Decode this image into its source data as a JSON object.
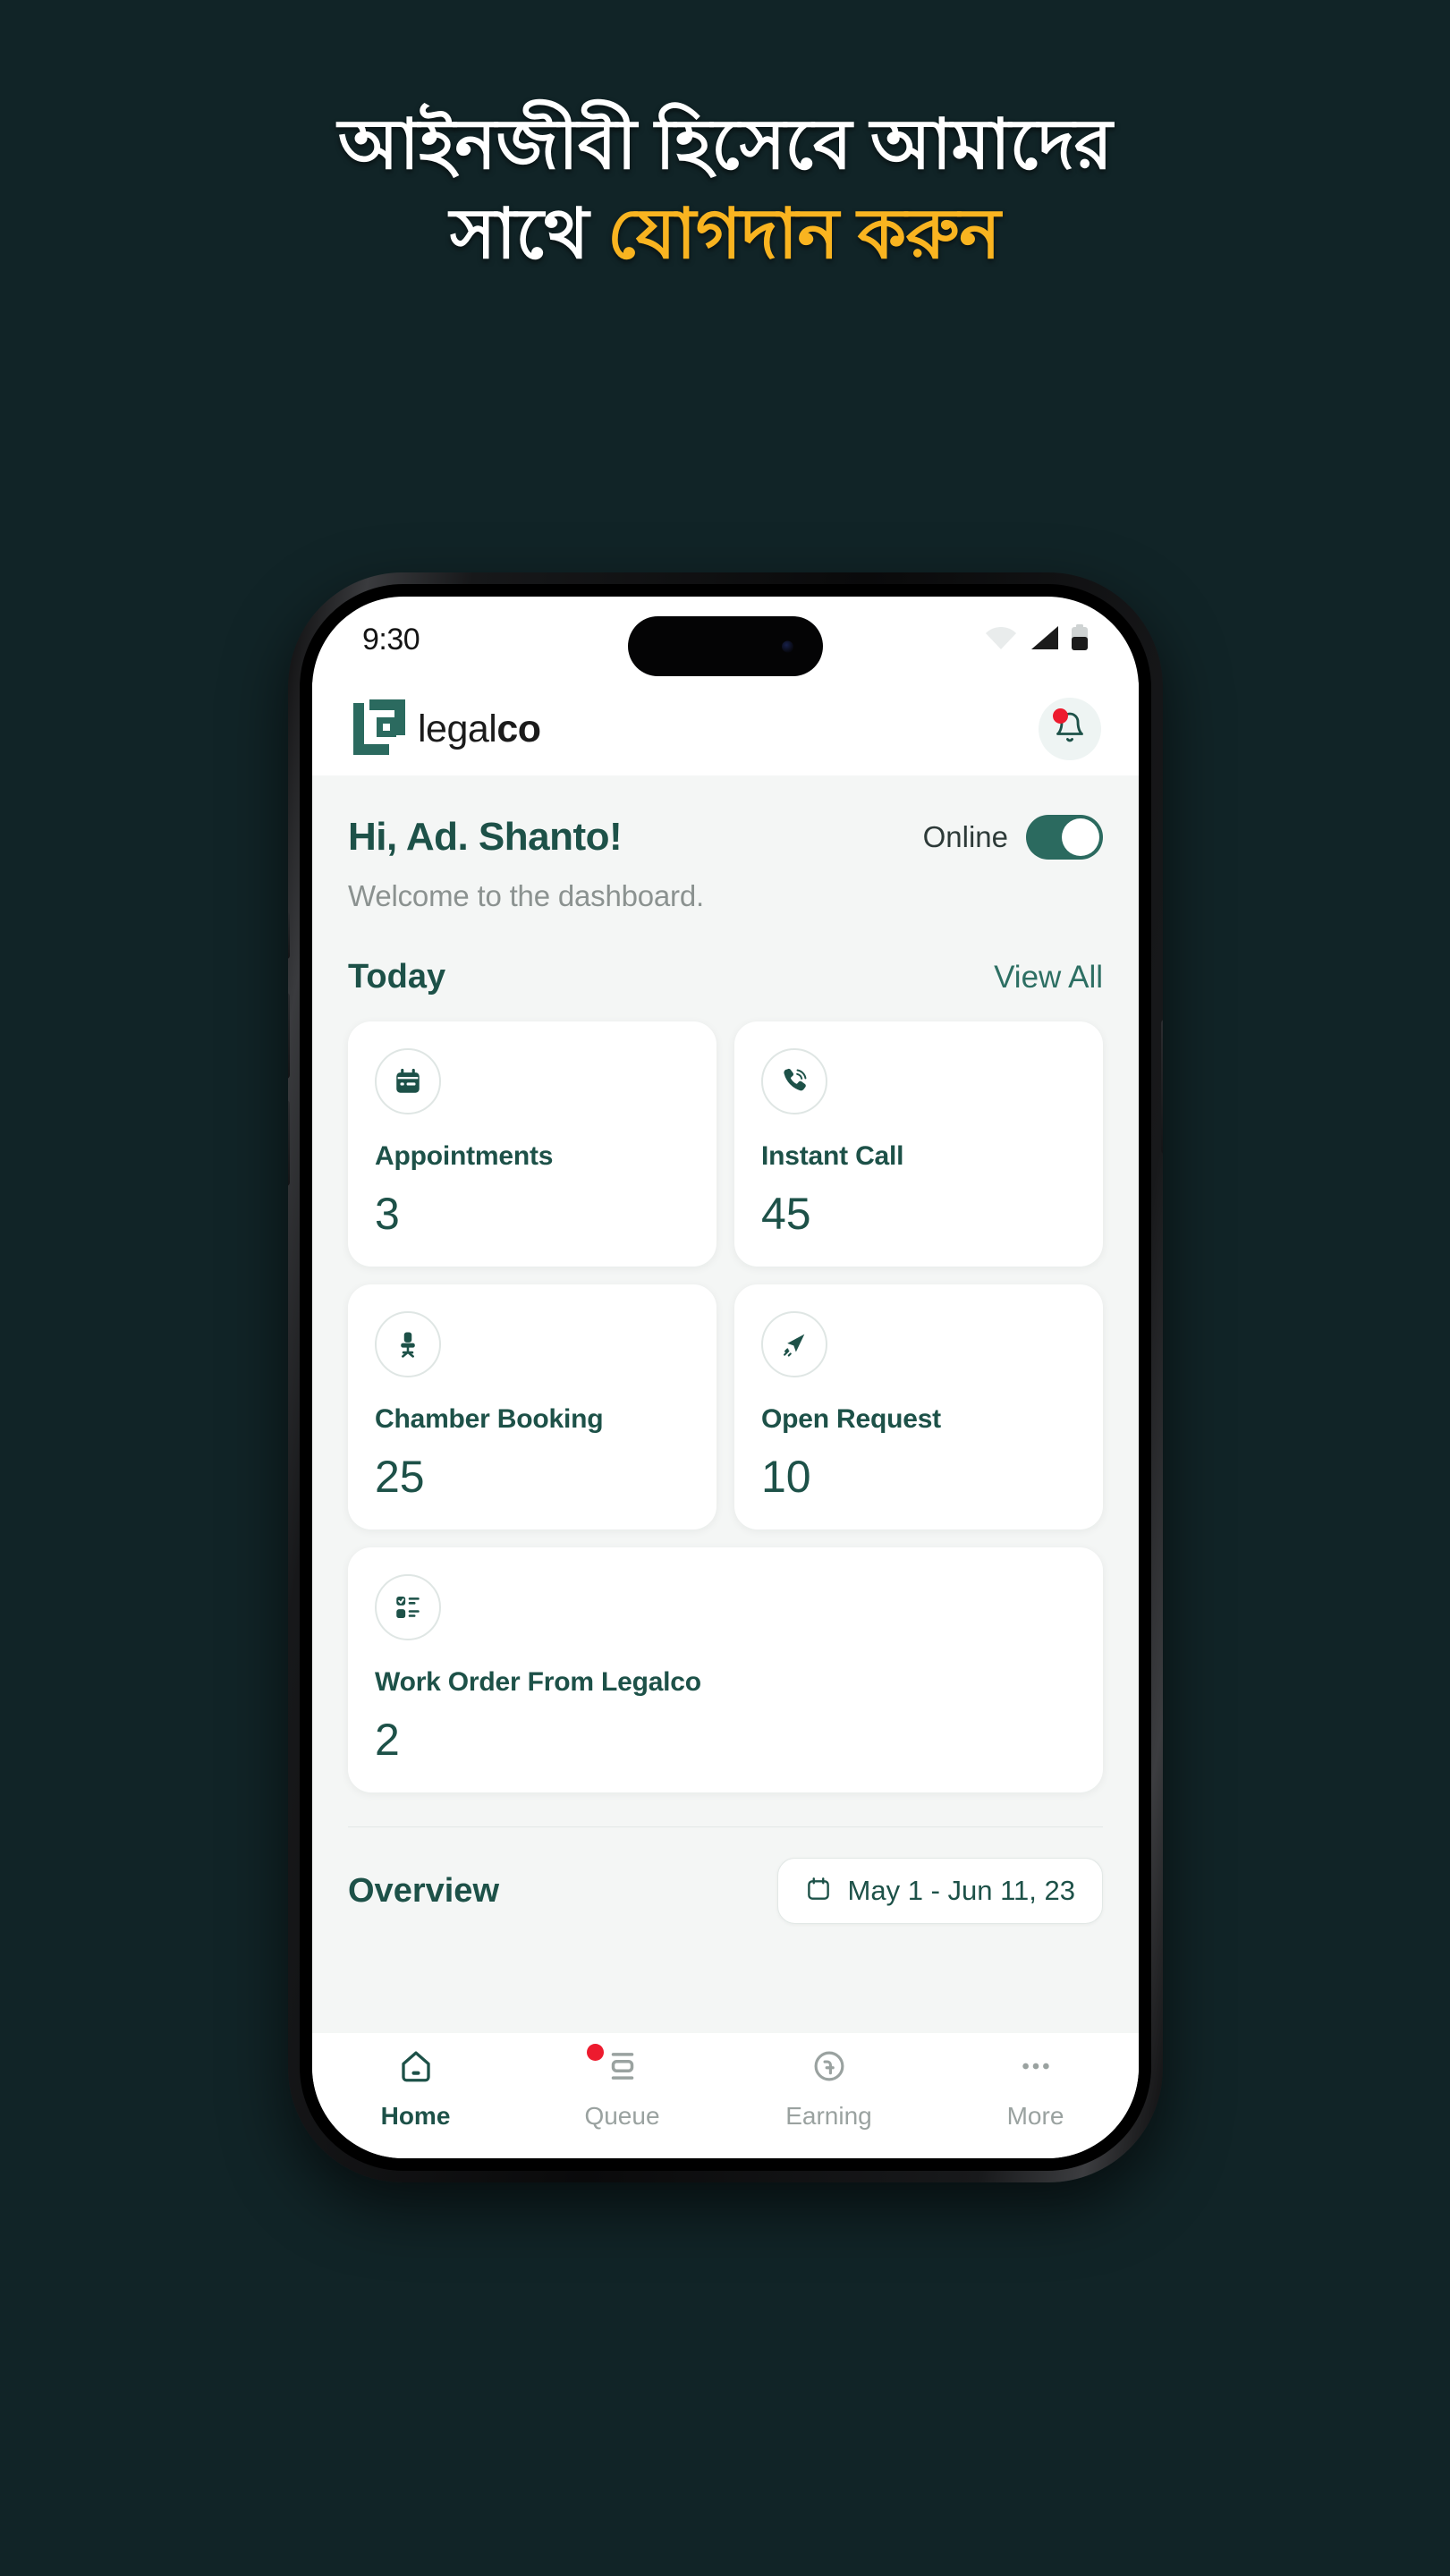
{
  "promo": {
    "headline_line1": "আইনজীবী হিসেবে আমাদের",
    "headline_line2_white": "সাথে ",
    "headline_line2_accent": "যোগদান করুন",
    "background_color": "#112427",
    "accent_color": "#F9B420"
  },
  "status_bar": {
    "time": "9:30",
    "icons": [
      "wifi-icon",
      "cellular-signal-icon",
      "battery-icon"
    ]
  },
  "app_header": {
    "brand_light": "legal",
    "brand_bold": "co",
    "logo_icon": "legalco-logo-icon",
    "notification_icon": "bell-icon",
    "notification_badge": true
  },
  "greeting": {
    "title": "Hi, Ad. Shanto!",
    "subtitle": "Welcome to the dashboard.",
    "online_label": "Online",
    "online_state": "on"
  },
  "today": {
    "title": "Today",
    "view_all": "View All",
    "cards": [
      {
        "icon": "calendar-icon",
        "label": "Appointments",
        "value": "3"
      },
      {
        "icon": "phone-ringing-icon",
        "label": "Instant Call",
        "value": "45"
      },
      {
        "icon": "office-chair-icon",
        "label": "Chamber Booking",
        "value": "25"
      },
      {
        "icon": "paper-plane-icon",
        "label": "Open Request",
        "value": "10"
      },
      {
        "icon": "checklist-icon",
        "label": "Work Order From Legalco",
        "value": "2"
      }
    ]
  },
  "overview": {
    "title": "Overview",
    "date_range": "May 1 - Jun 11, 23",
    "calendar_icon": "calendar-icon"
  },
  "bottom_nav": {
    "items": [
      {
        "label": "Home",
        "icon": "home-icon",
        "active": true,
        "badge": false
      },
      {
        "label": "Queue",
        "icon": "queue-icon",
        "active": false,
        "badge": true
      },
      {
        "label": "Earning",
        "icon": "taka-circle-icon",
        "active": false,
        "badge": false
      },
      {
        "label": "More",
        "icon": "ellipsis-icon",
        "active": false,
        "badge": false
      }
    ]
  },
  "theme": {
    "primary": "#1d5148",
    "screen_bg": "#f4f6f5",
    "badge_red": "#ed1b2e"
  }
}
